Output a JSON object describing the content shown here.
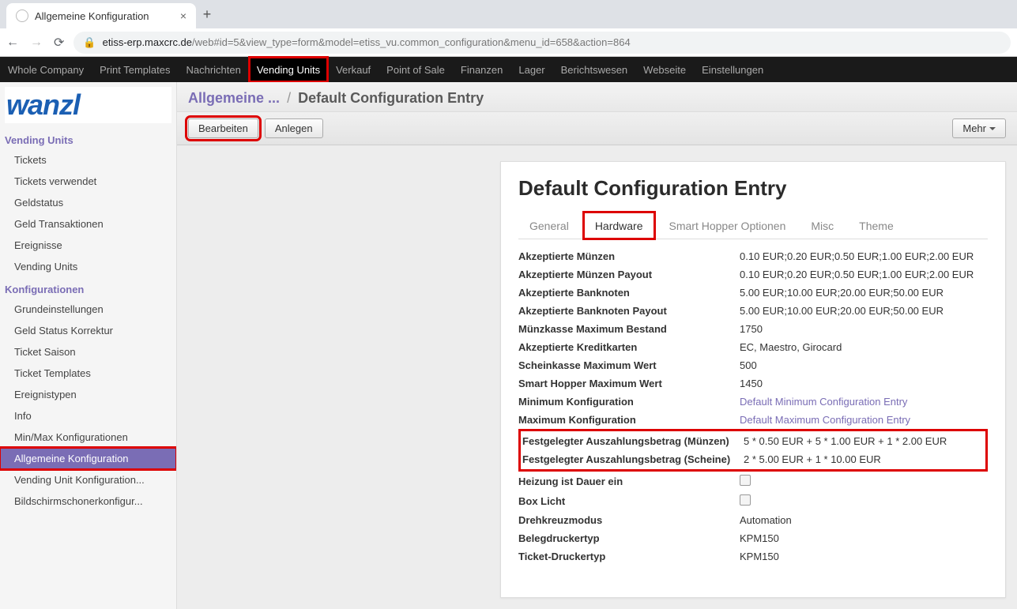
{
  "browser": {
    "tab_title": "Allgemeine Konfiguration",
    "url_domain": "etiss-erp.maxcrc.de",
    "url_path": "/web#id=5&view_type=form&model=etiss_vu.common_configuration&menu_id=658&action=864"
  },
  "topnav": {
    "items": [
      "Whole Company",
      "Print Templates",
      "Nachrichten",
      "Vending Units",
      "Verkauf",
      "Point of Sale",
      "Finanzen",
      "Lager",
      "Berichtswesen",
      "Webseite",
      "Einstellungen"
    ],
    "active_index": 3
  },
  "logo_text": "wanzl",
  "sidebar": {
    "section1_title": "Vending Units",
    "section1_items": [
      "Tickets",
      "Tickets verwendet",
      "Geldstatus",
      "Geld Transaktionen",
      "Ereignisse",
      "Vending Units"
    ],
    "section2_title": "Konfigurationen",
    "section2_items": [
      "Grundeinstellungen",
      "Geld Status Korrektur",
      "Ticket Saison",
      "Ticket Templates",
      "Ereignistypen",
      "Info",
      "Min/Max Konfigurationen",
      "Allgemeine Konfiguration",
      "Vending Unit Konfiguration...",
      "Bildschirmschonerkonfigur..."
    ],
    "active_item": "Allgemeine Konfiguration"
  },
  "breadcrumb": {
    "root": "Allgemeine ...",
    "leaf": "Default Configuration Entry"
  },
  "buttons": {
    "edit": "Bearbeiten",
    "create": "Anlegen",
    "more": "Mehr"
  },
  "card": {
    "title": "Default Configuration Entry",
    "tabs": [
      "General",
      "Hardware",
      "Smart Hopper Optionen",
      "Misc",
      "Theme"
    ],
    "active_tab": 1,
    "fields": [
      {
        "label": "Akzeptierte Münzen",
        "value": "0.10 EUR;0.20 EUR;0.50 EUR;1.00 EUR;2.00 EUR"
      },
      {
        "label": "Akzeptierte Münzen Payout",
        "value": "0.10 EUR;0.20 EUR;0.50 EUR;1.00 EUR;2.00 EUR"
      },
      {
        "label": "Akzeptierte Banknoten",
        "value": "5.00 EUR;10.00 EUR;20.00 EUR;50.00 EUR"
      },
      {
        "label": "Akzeptierte Banknoten Payout",
        "value": "5.00 EUR;10.00 EUR;20.00 EUR;50.00 EUR"
      },
      {
        "label": "Münzkasse Maximum Bestand",
        "value": "1750"
      },
      {
        "label": "Akzeptierte Kreditkarten",
        "value": "EC, Maestro, Girocard"
      },
      {
        "label": "Scheinkasse Maximum Wert",
        "value": "500"
      },
      {
        "label": "Smart Hopper Maximum Wert",
        "value": "1450"
      },
      {
        "label": "Minimum Konfiguration",
        "value": "Default Minimum Configuration Entry",
        "link": true
      },
      {
        "label": "Maximum Konfiguration",
        "value": "Default Maximum Configuration Entry",
        "link": true
      },
      {
        "label": "Festgelegter Auszahlungsbetrag (Münzen)",
        "value": "5 * 0.50 EUR + 5 * 1.00 EUR + 1 * 2.00 EUR",
        "hl": true
      },
      {
        "label": "Festgelegter Auszahlungsbetrag (Scheine)",
        "value": "2 * 5.00 EUR + 1 * 10.00 EUR",
        "hl": true
      },
      {
        "label": "Heizung ist Dauer ein",
        "checkbox": true
      },
      {
        "label": "Box Licht",
        "checkbox": true
      },
      {
        "label": "Drehkreuzmodus",
        "value": "Automation"
      },
      {
        "label": "Belegdruckertyp",
        "value": "KPM150"
      },
      {
        "label": "Ticket-Druckertyp",
        "value": "KPM150"
      }
    ]
  }
}
